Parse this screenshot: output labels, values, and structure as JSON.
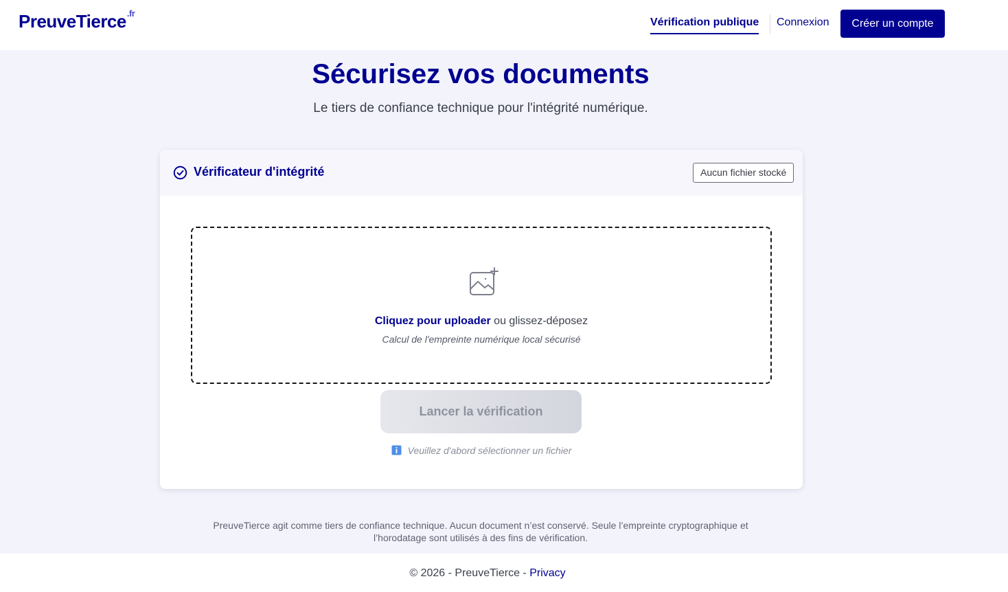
{
  "header": {
    "brand": "PreuveTierce",
    "brand_suffix": ".fr",
    "nav_public": "Vérification publique",
    "nav_login": "Connexion",
    "create_account": "Créer un compte"
  },
  "hero": {
    "title": "Sécurisez vos documents",
    "subtitle": "Le tiers de confiance technique pour l'intégrité numérique."
  },
  "verifier": {
    "title": "Vérificateur d'intégrité",
    "status_badge": "Aucun fichier stocké",
    "upload_link": "Cliquez pour uploader",
    "upload_rest": " ou glissez-déposez",
    "upload_note": "Calcul de l'empreinte numérique local sécurisé",
    "verify_button": "Lancer la vérification",
    "hint": "Veuillez d'abord sélectionner un fichier"
  },
  "disclaimer": "PreuveTierce agit comme tiers de confiance technique. Aucun document n’est conservé. Seule l’empreinte cryptographique et l’horodatage sont utilisés à des fins de vérification.",
  "footer": {
    "copyright": "© 2026 - PreuveTierce - ",
    "privacy": "Privacy"
  },
  "icons": {
    "check": "circle-check-icon",
    "upload": "image-add-icon",
    "info": "info-icon"
  },
  "colors": {
    "primary": "#000091",
    "background": "#f3f3fb"
  }
}
